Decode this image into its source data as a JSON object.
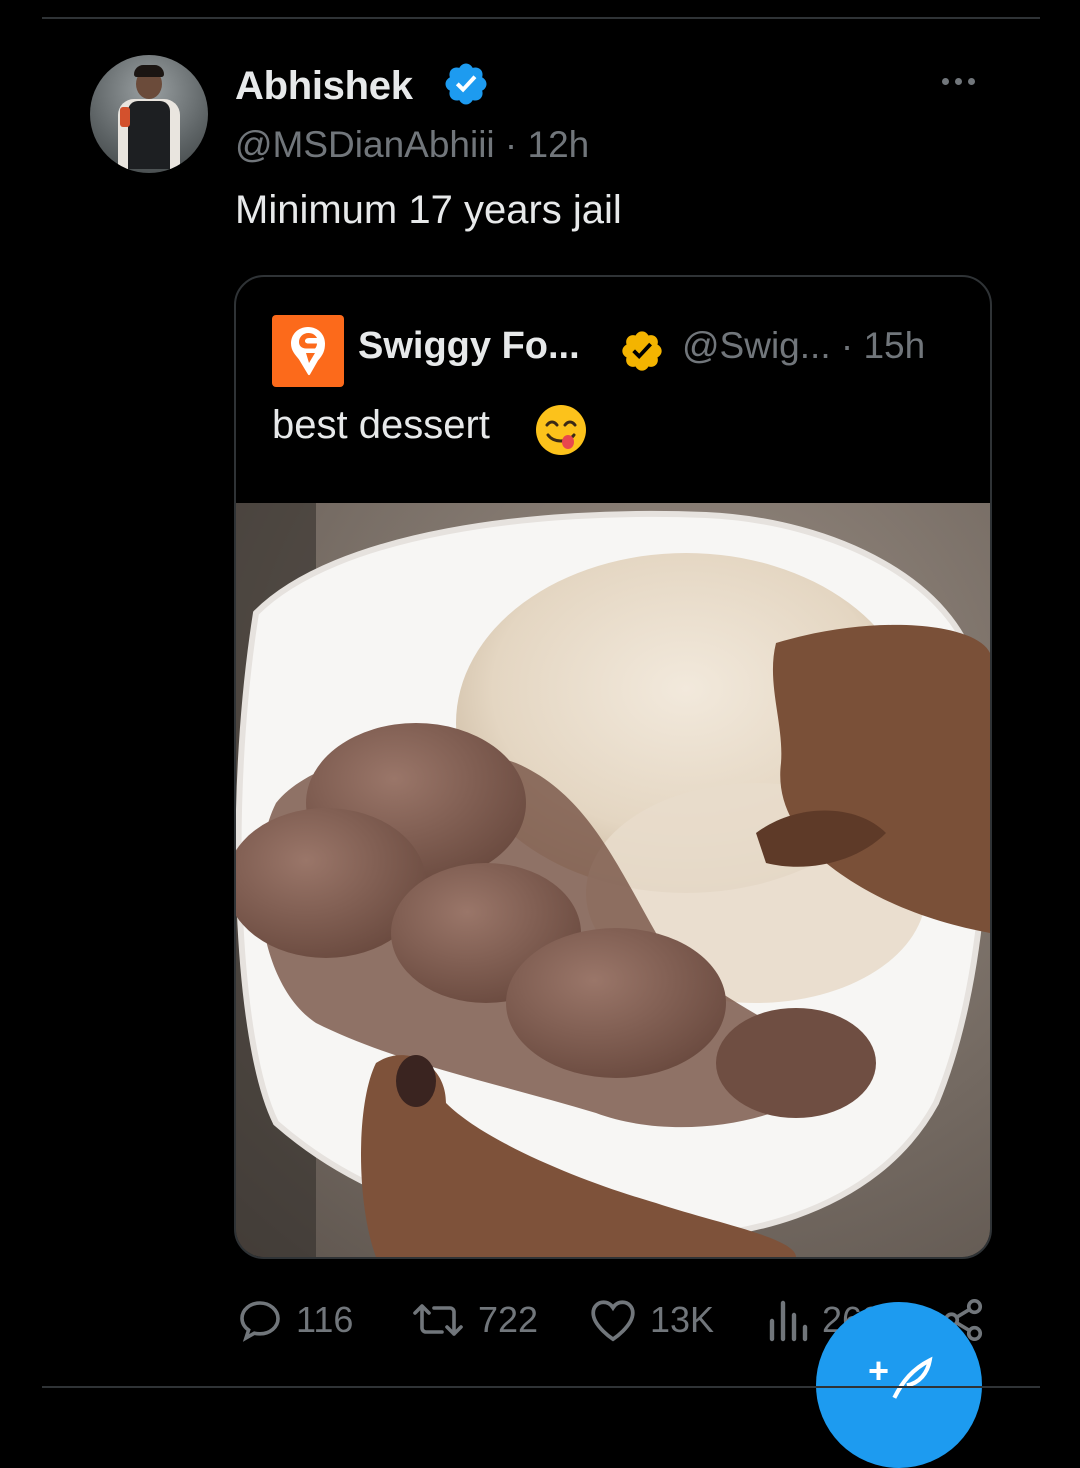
{
  "tweet": {
    "author_name": "Abhishek",
    "handle_time": "@MSDianAbhiii · 12h",
    "text": "Minimum 17 years jail",
    "verified_color": "#1d9bf0"
  },
  "quoted": {
    "author_name": "Swiggy Fo...",
    "handle_time": "@Swig... · 15h",
    "text": "best dessert",
    "emoji": "face-savoring-food",
    "brand_color": "#fc6a1b",
    "verified_color": "#f4b400"
  },
  "actions": {
    "replies": "116",
    "reposts": "722",
    "likes": "13K",
    "views": "268K"
  },
  "icons": [
    "verified-badge-icon",
    "more-icon",
    "reply-icon",
    "repost-icon",
    "like-icon",
    "views-icon",
    "share-icon",
    "compose-icon"
  ],
  "colors": {
    "background": "#000000",
    "text": "#e7e9ea",
    "muted": "#71767b",
    "accent": "#1d9bf0"
  }
}
